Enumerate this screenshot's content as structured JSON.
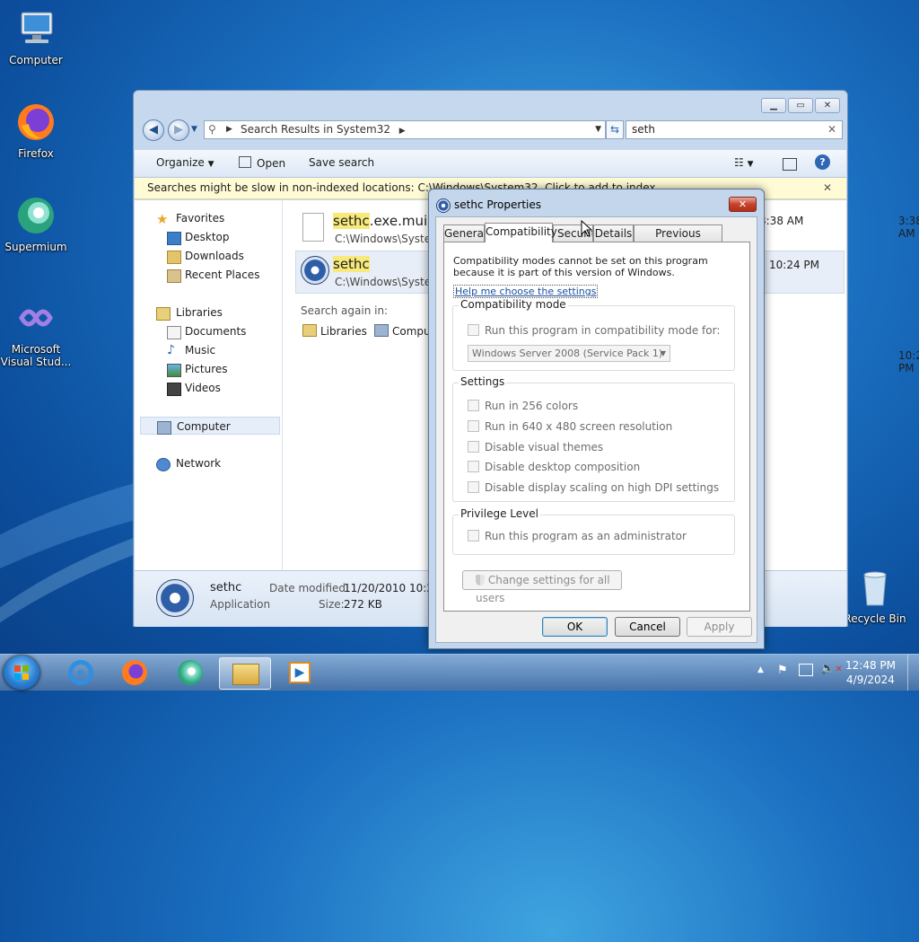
{
  "desktop": {
    "icons": [
      {
        "label": "Computer",
        "icon": "computer-icon"
      },
      {
        "label": "Firefox",
        "icon": "firefox-icon"
      },
      {
        "label": "Supermium",
        "icon": "supermium-icon"
      },
      {
        "label": "Microsoft Visual Stud...",
        "icon": "visual-studio-icon"
      },
      {
        "label": "Recycle Bin",
        "icon": "recycle-bin-icon"
      }
    ]
  },
  "explorer": {
    "address": "Search Results in System32",
    "search_value": "seth",
    "toolbar": {
      "organize": "Organize",
      "open": "Open",
      "save_search": "Save search"
    },
    "infobar": "Searches might be slow in non-indexed locations: C:\\Windows\\System32. Click to add to index...",
    "nav": {
      "favorites": "Favorites",
      "desktop": "Desktop",
      "downloads": "Downloads",
      "recent": "Recent Places",
      "libraries": "Libraries",
      "documents": "Documents",
      "music": "Music",
      "pictures": "Pictures",
      "videos": "Videos",
      "computer": "Computer",
      "network": "Network"
    },
    "results": [
      {
        "highlight": "sethc",
        "rest": ".exe.mui",
        "path": "C:\\Windows\\System32",
        "time": "3:38 AM"
      },
      {
        "highlight": "sethc",
        "rest": "",
        "path": "C:\\Windows\\System32",
        "time": "10:24 PM"
      }
    ],
    "search_again": "Search again in:",
    "search_again_libraries": "Libraries",
    "search_again_computer": "Computer",
    "details": {
      "name": "sethc",
      "type": "Application",
      "modified_label": "Date modified:",
      "modified_value": "11/20/2010 10:24 PM",
      "size_label": "Size:",
      "size_value": "272 KB"
    }
  },
  "dialog": {
    "title": "sethc Properties",
    "tabs": [
      "General",
      "Compatibility",
      "Security",
      "Details",
      "Previous Versions"
    ],
    "active_tab": "Compatibility",
    "intro": "Compatibility modes cannot be set on this program because it is part of this version of Windows.",
    "help_link": "Help me choose the settings",
    "compat_group": "Compatibility mode",
    "compat_check": "Run this program in compatibility mode for:",
    "compat_select": "Windows Server 2008 (Service Pack 1)",
    "settings_group": "Settings",
    "settings": [
      "Run in 256 colors",
      "Run in 640 x 480 screen resolution",
      "Disable visual themes",
      "Disable desktop composition",
      "Disable display scaling on high DPI settings"
    ],
    "privilege_group": "Privilege Level",
    "privilege_check": "Run this program as an administrator",
    "change_all": "Change settings for all users",
    "ok": "OK",
    "cancel": "Cancel",
    "apply": "Apply"
  },
  "taskbar": {
    "time": "12:48 PM",
    "date": "4/9/2024",
    "pinned": [
      "internet-explorer-icon",
      "firefox-icon",
      "supermium-icon",
      "explorer-icon",
      "media-player-icon"
    ]
  },
  "colors": {
    "accent": "#1b6fc0",
    "highlight": "#f7e97a",
    "close_red": "#c7422d"
  }
}
